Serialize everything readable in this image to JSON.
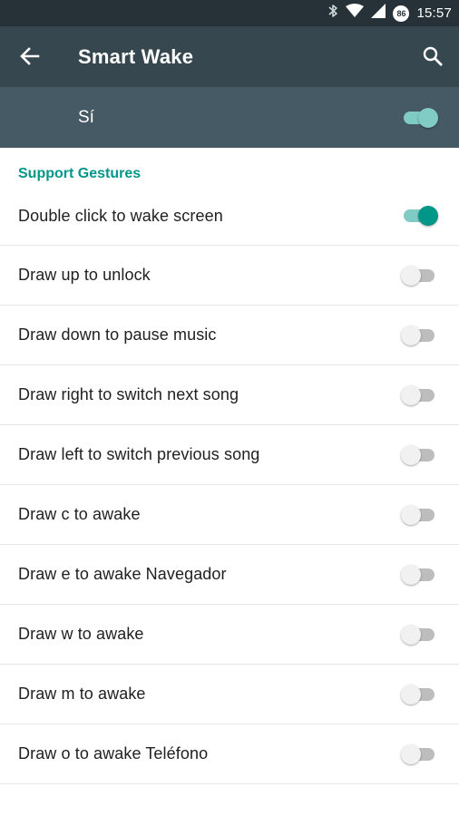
{
  "status_bar": {
    "time": "15:57",
    "battery_level": "86",
    "icons": [
      "bluetooth-icon",
      "wifi-icon",
      "cell-signal-icon",
      "battery-icon"
    ]
  },
  "toolbar": {
    "title": "Smart Wake",
    "back_icon": "arrow-left-icon",
    "search_icon": "search-icon",
    "background": "#37474f"
  },
  "master": {
    "label": "Sí",
    "enabled": true,
    "background": "#455a64"
  },
  "section": {
    "title": "Support Gestures",
    "color": "#009688"
  },
  "gestures": [
    {
      "label": "Double click to wake screen",
      "enabled": true
    },
    {
      "label": "Draw up to unlock",
      "enabled": false
    },
    {
      "label": "Draw down to pause music",
      "enabled": false
    },
    {
      "label": "Draw right to switch next song",
      "enabled": false
    },
    {
      "label": "Draw left to switch previous song",
      "enabled": false
    },
    {
      "label": "Draw c to awake",
      "enabled": false
    },
    {
      "label": "Draw e to awake Navegador",
      "enabled": false
    },
    {
      "label": "Draw w to awake",
      "enabled": false
    },
    {
      "label": "Draw m to awake",
      "enabled": false
    },
    {
      "label": "Draw o to awake Teléfono",
      "enabled": false
    }
  ],
  "colors": {
    "accent": "#009688",
    "accent_light": "#80cbc4",
    "switch_off_track": "#bdbdbd",
    "switch_off_thumb": "#f1f1f1"
  }
}
